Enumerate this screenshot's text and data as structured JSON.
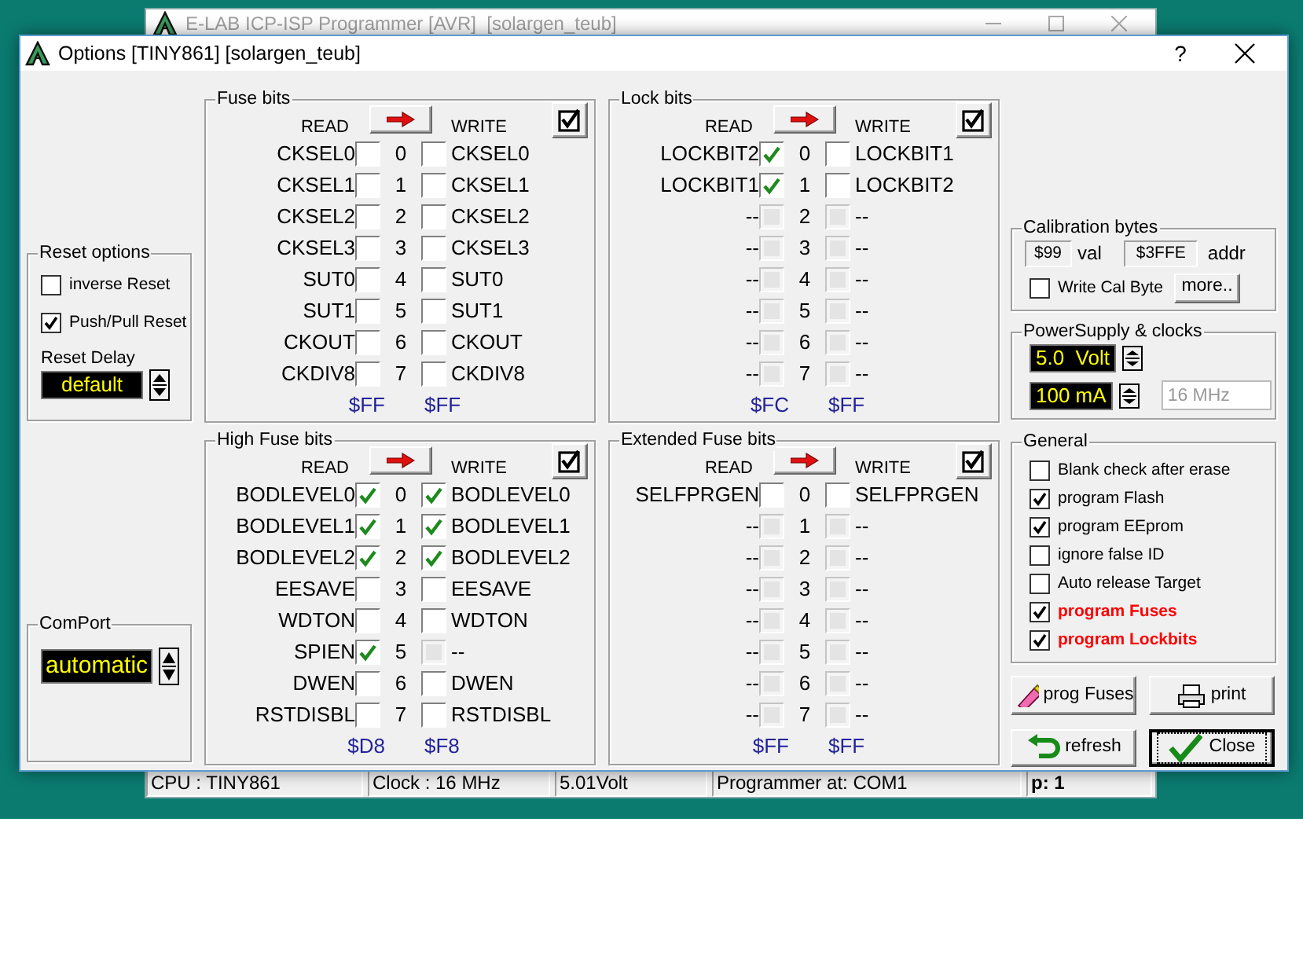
{
  "back_window": {
    "title": "E-LAB ICP-ISP Programmer [AVR]  [solargen_teub]",
    "status_bar": [
      "CPU : TINY861",
      "Clock : 16 MHz",
      "5.01Volt",
      "Programmer at: COM1",
      "p: 1"
    ]
  },
  "dialog": {
    "title": "Options [TINY861] [solargen_teub]",
    "help_button": "?"
  },
  "reset_options": {
    "title": "Reset options",
    "options": [
      {
        "label": "inverse Reset",
        "checked": false
      },
      {
        "label": "Push/Pull Reset",
        "checked": true
      }
    ],
    "delay_label": "Reset Delay",
    "delay_value": "default"
  },
  "comport": {
    "title": "ComPort",
    "value": "automatic"
  },
  "fuse_panels": [
    {
      "title": "Fuse bits",
      "read_label": "READ",
      "write_label": "WRITE",
      "read_value": "$FF",
      "write_value": "$FF",
      "bits": [
        {
          "read_name": "CKSEL0",
          "read_checked": false,
          "read_disabled": false,
          "index": "0",
          "write_checked": false,
          "write_disabled": false,
          "write_name": "CKSEL0"
        },
        {
          "read_name": "CKSEL1",
          "read_checked": false,
          "read_disabled": false,
          "index": "1",
          "write_checked": false,
          "write_disabled": false,
          "write_name": "CKSEL1"
        },
        {
          "read_name": "CKSEL2",
          "read_checked": false,
          "read_disabled": false,
          "index": "2",
          "write_checked": false,
          "write_disabled": false,
          "write_name": "CKSEL2"
        },
        {
          "read_name": "CKSEL3",
          "read_checked": false,
          "read_disabled": false,
          "index": "3",
          "write_checked": false,
          "write_disabled": false,
          "write_name": "CKSEL3"
        },
        {
          "read_name": "SUT0",
          "read_checked": false,
          "read_disabled": false,
          "index": "4",
          "write_checked": false,
          "write_disabled": false,
          "write_name": "SUT0"
        },
        {
          "read_name": "SUT1",
          "read_checked": false,
          "read_disabled": false,
          "index": "5",
          "write_checked": false,
          "write_disabled": false,
          "write_name": "SUT1"
        },
        {
          "read_name": "CKOUT",
          "read_checked": false,
          "read_disabled": false,
          "index": "6",
          "write_checked": false,
          "write_disabled": false,
          "write_name": "CKOUT"
        },
        {
          "read_name": "CKDIV8",
          "read_checked": false,
          "read_disabled": false,
          "index": "7",
          "write_checked": false,
          "write_disabled": false,
          "write_name": "CKDIV8"
        }
      ]
    },
    {
      "title": "Lock bits",
      "read_label": "READ",
      "write_label": "WRITE",
      "read_value": "$FC",
      "write_value": "$FF",
      "bits": [
        {
          "read_name": "LOCKBIT2",
          "read_checked": true,
          "read_disabled": false,
          "index": "0",
          "write_checked": false,
          "write_disabled": false,
          "write_name": "LOCKBIT1"
        },
        {
          "read_name": "LOCKBIT1",
          "read_checked": true,
          "read_disabled": false,
          "index": "1",
          "write_checked": false,
          "write_disabled": false,
          "write_name": "LOCKBIT2"
        },
        {
          "read_name": "--",
          "read_checked": false,
          "read_disabled": true,
          "index": "2",
          "write_checked": false,
          "write_disabled": true,
          "write_name": "--"
        },
        {
          "read_name": "--",
          "read_checked": false,
          "read_disabled": true,
          "index": "3",
          "write_checked": false,
          "write_disabled": true,
          "write_name": "--"
        },
        {
          "read_name": "--",
          "read_checked": false,
          "read_disabled": true,
          "index": "4",
          "write_checked": false,
          "write_disabled": true,
          "write_name": "--"
        },
        {
          "read_name": "--",
          "read_checked": false,
          "read_disabled": true,
          "index": "5",
          "write_checked": false,
          "write_disabled": true,
          "write_name": "--"
        },
        {
          "read_name": "--",
          "read_checked": false,
          "read_disabled": true,
          "index": "6",
          "write_checked": false,
          "write_disabled": true,
          "write_name": "--"
        },
        {
          "read_name": "--",
          "read_checked": false,
          "read_disabled": true,
          "index": "7",
          "write_checked": false,
          "write_disabled": true,
          "write_name": "--"
        }
      ]
    },
    {
      "title": "High Fuse bits",
      "read_label": "READ",
      "write_label": "WRITE",
      "read_value": "$D8",
      "write_value": "$F8",
      "bits": [
        {
          "read_name": "BODLEVEL0",
          "read_checked": true,
          "read_disabled": false,
          "index": "0",
          "write_checked": true,
          "write_disabled": false,
          "write_name": "BODLEVEL0"
        },
        {
          "read_name": "BODLEVEL1",
          "read_checked": true,
          "read_disabled": false,
          "index": "1",
          "write_checked": true,
          "write_disabled": false,
          "write_name": "BODLEVEL1"
        },
        {
          "read_name": "BODLEVEL2",
          "read_checked": true,
          "read_disabled": false,
          "index": "2",
          "write_checked": true,
          "write_disabled": false,
          "write_name": "BODLEVEL2"
        },
        {
          "read_name": "EESAVE",
          "read_checked": false,
          "read_disabled": false,
          "index": "3",
          "write_checked": false,
          "write_disabled": false,
          "write_name": "EESAVE"
        },
        {
          "read_name": "WDTON",
          "read_checked": false,
          "read_disabled": false,
          "index": "4",
          "write_checked": false,
          "write_disabled": false,
          "write_name": "WDTON"
        },
        {
          "read_name": "SPIEN",
          "read_checked": true,
          "read_disabled": false,
          "index": "5",
          "write_checked": false,
          "write_disabled": true,
          "write_name": "--"
        },
        {
          "read_name": "DWEN",
          "read_checked": false,
          "read_disabled": false,
          "index": "6",
          "write_checked": false,
          "write_disabled": false,
          "write_name": "DWEN"
        },
        {
          "read_name": "RSTDISBL",
          "read_checked": false,
          "read_disabled": false,
          "index": "7",
          "write_checked": false,
          "write_disabled": false,
          "write_name": "RSTDISBL"
        }
      ]
    },
    {
      "title": "Extended Fuse bits",
      "read_label": "READ",
      "write_label": "WRITE",
      "read_value": "$FF",
      "write_value": "$FF",
      "bits": [
        {
          "read_name": "SELFPRGEN",
          "read_checked": false,
          "read_disabled": false,
          "index": "0",
          "write_checked": false,
          "write_disabled": false,
          "write_name": "SELFPRGEN"
        },
        {
          "read_name": "--",
          "read_checked": false,
          "read_disabled": true,
          "index": "1",
          "write_checked": false,
          "write_disabled": true,
          "write_name": "--"
        },
        {
          "read_name": "--",
          "read_checked": false,
          "read_disabled": true,
          "index": "2",
          "write_checked": false,
          "write_disabled": true,
          "write_name": "--"
        },
        {
          "read_name": "--",
          "read_checked": false,
          "read_disabled": true,
          "index": "3",
          "write_checked": false,
          "write_disabled": true,
          "write_name": "--"
        },
        {
          "read_name": "--",
          "read_checked": false,
          "read_disabled": true,
          "index": "4",
          "write_checked": false,
          "write_disabled": true,
          "write_name": "--"
        },
        {
          "read_name": "--",
          "read_checked": false,
          "read_disabled": true,
          "index": "5",
          "write_checked": false,
          "write_disabled": true,
          "write_name": "--"
        },
        {
          "read_name": "--",
          "read_checked": false,
          "read_disabled": true,
          "index": "6",
          "write_checked": false,
          "write_disabled": true,
          "write_name": "--"
        },
        {
          "read_name": "--",
          "read_checked": false,
          "read_disabled": true,
          "index": "7",
          "write_checked": false,
          "write_disabled": true,
          "write_name": "--"
        }
      ]
    }
  ],
  "calibration": {
    "title": "Calibration bytes",
    "value": "$99",
    "value_label": "val",
    "address": "$3FFE",
    "address_label": "addr",
    "write_cal": {
      "label": "Write Cal Byte",
      "checked": false
    },
    "more_button": "more.."
  },
  "power": {
    "title": "PowerSupply & clocks",
    "voltage": "5.0  Volt",
    "current": "100 mA",
    "clock": "16 MHz"
  },
  "general": {
    "title": "General",
    "options": [
      {
        "label": "Blank check after erase",
        "checked": false,
        "color": "#000000"
      },
      {
        "label": "program Flash",
        "checked": true,
        "color": "#000000"
      },
      {
        "label": "program EEprom",
        "checked": true,
        "color": "#000000"
      },
      {
        "label": "ignore false ID",
        "checked": false,
        "color": "#000000"
      },
      {
        "label": "Auto release Target",
        "checked": false,
        "color": "#000000"
      },
      {
        "label": "program Fuses",
        "checked": true,
        "color": "#ff0000"
      },
      {
        "label": "program Lockbits",
        "checked": true,
        "color": "#ff0000"
      }
    ]
  },
  "buttons": [
    {
      "label": "prog Fuses",
      "kind": "prog",
      "default": false
    },
    {
      "label": "print",
      "kind": "print",
      "default": false
    },
    {
      "label": "refresh",
      "kind": "refresh",
      "default": false
    },
    {
      "label": "Close",
      "kind": "close",
      "default": true
    }
  ]
}
